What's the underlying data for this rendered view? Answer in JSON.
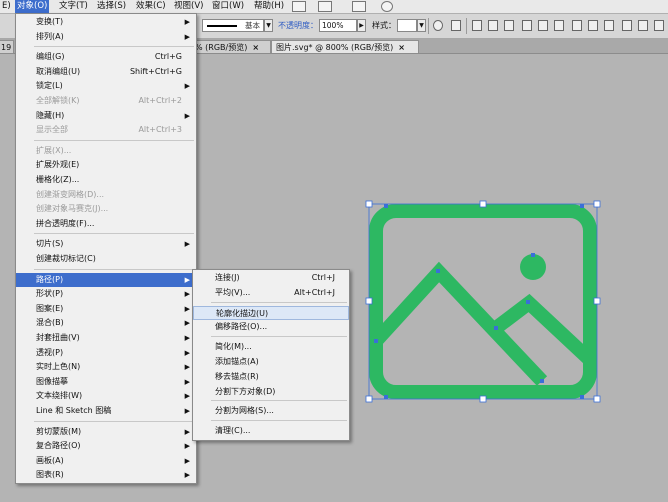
{
  "menubar": {
    "items": [
      {
        "label": "E)",
        "active": false
      },
      {
        "label": "对象(O)",
        "active": true
      },
      {
        "label": "文字(T)",
        "active": false
      },
      {
        "label": "选择(S)",
        "active": false
      },
      {
        "label": "效果(C)",
        "active": false
      },
      {
        "label": "视图(V)",
        "active": false
      },
      {
        "label": "窗口(W)",
        "active": false
      },
      {
        "label": "帮助(H)",
        "active": false
      }
    ]
  },
  "controlbar": {
    "stroke_style": "基本",
    "opacity_label": "不透明度：",
    "opacity_value": "100%",
    "style_label": "样式："
  },
  "tabs": [
    {
      "label": "% (RGB/预览)",
      "close": "×"
    },
    {
      "label": "图片.svg* @ 800% (RGB/预览)",
      "close": "×"
    }
  ],
  "tabs_left_fragment": "19",
  "object_menu": {
    "items": [
      {
        "label": "变换(T)",
        "shortcut": "",
        "submenu": true,
        "disabled": false
      },
      {
        "label": "排列(A)",
        "shortcut": "",
        "submenu": true,
        "disabled": false
      },
      {
        "sep": true
      },
      {
        "label": "编组(G)",
        "shortcut": "Ctrl+G",
        "submenu": false,
        "disabled": false
      },
      {
        "label": "取消编组(U)",
        "shortcut": "Shift+Ctrl+G",
        "submenu": false,
        "disabled": false
      },
      {
        "label": "锁定(L)",
        "shortcut": "",
        "submenu": true,
        "disabled": false
      },
      {
        "label": "全部解锁(K)",
        "shortcut": "Alt+Ctrl+2",
        "submenu": false,
        "disabled": true
      },
      {
        "label": "隐藏(H)",
        "shortcut": "",
        "submenu": true,
        "disabled": false
      },
      {
        "label": "显示全部",
        "shortcut": "Alt+Ctrl+3",
        "submenu": false,
        "disabled": true
      },
      {
        "sep": true
      },
      {
        "label": "扩展(X)...",
        "shortcut": "",
        "submenu": false,
        "disabled": true
      },
      {
        "label": "扩展外观(E)",
        "shortcut": "",
        "submenu": false,
        "disabled": false
      },
      {
        "label": "栅格化(Z)...",
        "shortcut": "",
        "submenu": false,
        "disabled": false
      },
      {
        "label": "创建渐变网格(D)...",
        "shortcut": "",
        "submenu": false,
        "disabled": true
      },
      {
        "label": "创建对象马赛克(J)...",
        "shortcut": "",
        "submenu": false,
        "disabled": true
      },
      {
        "label": "拼合透明度(F)...",
        "shortcut": "",
        "submenu": false,
        "disabled": false
      },
      {
        "sep": true
      },
      {
        "label": "切片(S)",
        "shortcut": "",
        "submenu": true,
        "disabled": false
      },
      {
        "label": "创建裁切标记(C)",
        "shortcut": "",
        "submenu": false,
        "disabled": false
      },
      {
        "sep": true
      },
      {
        "label": "路径(P)",
        "shortcut": "",
        "submenu": true,
        "disabled": false,
        "selected": true
      },
      {
        "label": "形状(P)",
        "shortcut": "",
        "submenu": true,
        "disabled": false
      },
      {
        "label": "图案(E)",
        "shortcut": "",
        "submenu": true,
        "disabled": false
      },
      {
        "label": "混合(B)",
        "shortcut": "",
        "submenu": true,
        "disabled": false
      },
      {
        "label": "封套扭曲(V)",
        "shortcut": "",
        "submenu": true,
        "disabled": false
      },
      {
        "label": "透视(P)",
        "shortcut": "",
        "submenu": true,
        "disabled": false
      },
      {
        "label": "实时上色(N)",
        "shortcut": "",
        "submenu": true,
        "disabled": false
      },
      {
        "label": "图像描摹",
        "shortcut": "",
        "submenu": true,
        "disabled": false
      },
      {
        "label": "文本绕排(W)",
        "shortcut": "",
        "submenu": true,
        "disabled": false
      },
      {
        "label": "Line 和 Sketch 图稿",
        "shortcut": "",
        "submenu": true,
        "disabled": false
      },
      {
        "sep": true
      },
      {
        "label": "剪切蒙版(M)",
        "shortcut": "",
        "submenu": true,
        "disabled": false
      },
      {
        "label": "复合路径(O)",
        "shortcut": "",
        "submenu": true,
        "disabled": false
      },
      {
        "label": "画板(A)",
        "shortcut": "",
        "submenu": true,
        "disabled": false
      },
      {
        "label": "图表(R)",
        "shortcut": "",
        "submenu": true,
        "disabled": false
      }
    ]
  },
  "path_submenu": {
    "items": [
      {
        "label": "连接(J)",
        "shortcut": "Ctrl+J"
      },
      {
        "label": "平均(V)...",
        "shortcut": "Alt+Ctrl+J"
      },
      {
        "sep": true
      },
      {
        "label": "轮廓化描边(U)",
        "shortcut": "",
        "hover": true
      },
      {
        "label": "偏移路径(O)...",
        "shortcut": ""
      },
      {
        "sep": true
      },
      {
        "label": "简化(M)...",
        "shortcut": ""
      },
      {
        "label": "添加锚点(A)",
        "shortcut": ""
      },
      {
        "label": "移去锚点(R)",
        "shortcut": ""
      },
      {
        "label": "分割下方对象(D)",
        "shortcut": ""
      },
      {
        "sep": true
      },
      {
        "label": "分割为网格(S)...",
        "shortcut": ""
      },
      {
        "sep": true
      },
      {
        "label": "清理(C)...",
        "shortcut": ""
      }
    ]
  },
  "artwork": {
    "stroke_color": "#2db862",
    "anchor_color": "#3a6fd8",
    "icon": "image-icon"
  }
}
